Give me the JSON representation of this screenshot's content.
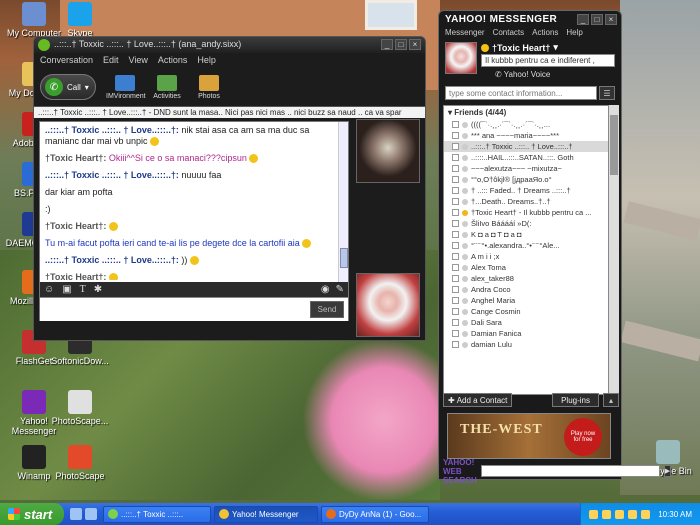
{
  "desktop": {
    "icons": [
      {
        "label": "My Computer",
        "color": "#6c8fd2"
      },
      {
        "label": "Skype",
        "color": "#1aa3ea"
      },
      {
        "label": "My Docum...",
        "color": "#e7c35a"
      },
      {
        "label": "Adobe R...",
        "color": "#c8221f"
      },
      {
        "label": "BS.Player",
        "color": "#2b6bd6"
      },
      {
        "label": "DAEMON Lite",
        "color": "#1f3a92"
      },
      {
        "label": "Mozilla Fir...",
        "color": "#e46c1b"
      },
      {
        "label": "FlashGet",
        "color": "#c62f2f"
      },
      {
        "label": "SoftonicDow...",
        "color": "#2c2c2c"
      },
      {
        "label": "Yahoo! Messenger",
        "color": "#7b2ab8"
      },
      {
        "label": "PhotoScape...",
        "color": "#e0e0e0"
      },
      {
        "label": "Winamp",
        "color": "#222"
      },
      {
        "label": "PhotoScape",
        "color": "#e34a2a"
      },
      {
        "label": "Recycle Bin",
        "color": "#9bb"
      }
    ]
  },
  "conversation": {
    "title": "..:::..† Toxxic ..:::.. † Love..:::..† (ana_andy.sixx)",
    "menu": [
      "Conversation",
      "Edit",
      "View",
      "Actions",
      "Help"
    ],
    "call_label": "Call",
    "tools": [
      {
        "label": "IMVironment",
        "color": "#3c7fd0"
      },
      {
        "label": "Activities",
        "color": "#5aa348"
      },
      {
        "label": "Photos",
        "color": "#d9a23b"
      }
    ],
    "status": "..:::..† Toxxic ..:::.. † Love..:::..† - DND sunt la masa.. Nici pas nici mas .. nici buzz sa naud .. ca va spar",
    "messages": [
      {
        "nick": "..:::..† Toxxic ..:::.. † Love..:::..†:",
        "text": "nik stai asa ca  am sa ma duc sa manianc dar mai vb unpic",
        "style": "a"
      },
      {
        "nick": "†Toxic Heart†:",
        "text": "Okiii^^Si ce o sa manaci???cipsun",
        "style": "b"
      },
      {
        "nick": "..:::..† Toxxic ..:::.. † Love..:::..†:",
        "text": "nuuuu faa",
        "style": "a"
      },
      {
        "nick": "",
        "text": "dar kiar am pofta",
        "style": "plain"
      },
      {
        "nick": "",
        "text": ":)",
        "style": "plain"
      },
      {
        "nick": "†Toxic Heart†:",
        "text": "",
        "style": "b"
      },
      {
        "nick": "",
        "text": "Tu m-ai facut pofta ieri cand te-ai lis pe degete dce la cartofii aia",
        "style": "blue"
      },
      {
        "nick": "..:::..† Toxxic ..:::.. † Love..:::..†:",
        "text": "))",
        "style": "a"
      },
      {
        "nick": "†Toxic Heart†:",
        "text": "",
        "style": "b"
      }
    ],
    "send_label": "Send"
  },
  "messenger": {
    "title": "YAHOO! MESSENGER",
    "menu": [
      "Messenger",
      "Contacts",
      "Actions",
      "Help"
    ],
    "my_name": "†Toxic Heart†",
    "my_status": "Il kubbb pentru ca e indiferent ,",
    "voice_label": "Yahoo! Voice",
    "search_placeholder": "type some contact information...",
    "group_header": "Friends (4/44)",
    "friends": [
      {
        "name": "((((¯`·.¸¸.·´¯`·.¸¸.·´¯`·.¸¸...",
        "online": false,
        "selected": false
      },
      {
        "name": "*** ana ~~~~maria~~~~***",
        "online": false,
        "selected": false
      },
      {
        "name": "..:::..† Toxxic ..:::.. † Love..:::..†",
        "online": false,
        "selected": true
      },
      {
        "name": "..::::..HAIL..:::..SATAN..:::. Goth",
        "online": false,
        "selected": false
      },
      {
        "name": "~~~alexutza~~~ ~mixutza~",
        "online": false,
        "selected": false
      },
      {
        "name": "°°o,O†ôkjl® [jдрааЯо.о°",
        "online": false,
        "selected": false
      },
      {
        "name": "† ..::: Faded.. † Dreams ..:::..†",
        "online": false,
        "selected": false
      },
      {
        "name": "†...Death.. Dreams..†..†",
        "online": false,
        "selected": false
      },
      {
        "name": "†Toxic Heart† - Il kubbb pentru ca ...",
        "online": true,
        "selected": false
      },
      {
        "name": "ŠliIvo Bááááí »D(:",
        "online": false,
        "selected": false
      },
      {
        "name": "K ◘ a ◘ T ◘ a ◘",
        "online": false,
        "selected": false
      },
      {
        "name": "°¨¨¨°•.alexandra..°•¨¨¨°Ale...",
        "online": false,
        "selected": false
      },
      {
        "name": "A m i i  ;x",
        "online": false,
        "selected": false
      },
      {
        "name": "Alex Toma",
        "online": false,
        "selected": false
      },
      {
        "name": "alex_taker88",
        "online": false,
        "selected": false
      },
      {
        "name": "Andra Coco",
        "online": false,
        "selected": false
      },
      {
        "name": "Anghel Maria",
        "online": false,
        "selected": false
      },
      {
        "name": "Cange Cosmin",
        "online": false,
        "selected": false
      },
      {
        "name": "Dali Sara",
        "online": false,
        "selected": false
      },
      {
        "name": "Damian Fanica",
        "online": false,
        "selected": false
      },
      {
        "name": "damian Lulu",
        "online": false,
        "selected": false
      }
    ],
    "add_contact_label": "Add a Contact",
    "plugins_label": "Plug-ins",
    "ad_title": "THE-WEST",
    "ad_play": "Play now for free",
    "web_search_label": "YAHOO! WEB SEARCH"
  },
  "taskbar": {
    "start_label": "start",
    "tasks": [
      {
        "label": "..:::..† Toxxic ..:::..",
        "color": "#7fd14a",
        "active": false
      },
      {
        "label": "Yahoo! Messenger",
        "color": "#f1c232",
        "active": true
      },
      {
        "label": "DyDy AnNa (1) - Goo...",
        "color": "#e46c1b",
        "active": false
      }
    ],
    "clock": "10:30 AM"
  }
}
